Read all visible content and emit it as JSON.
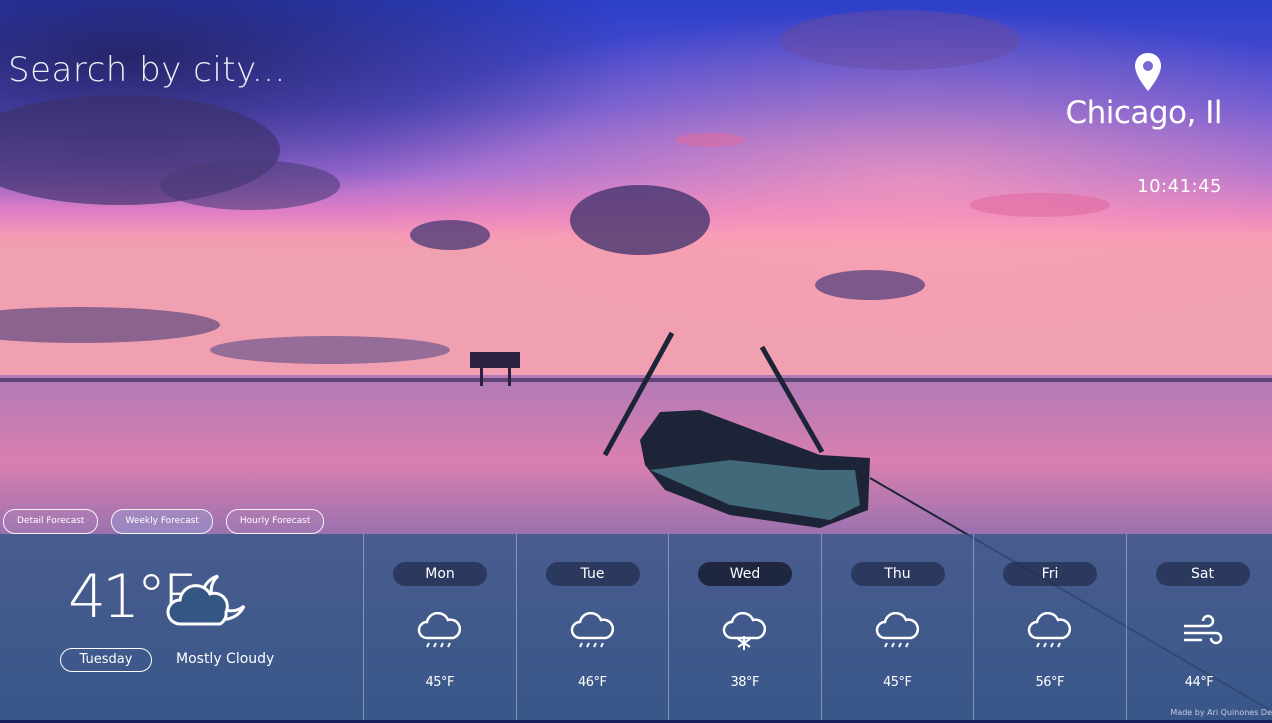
{
  "search": {
    "placeholder": "Search by city..."
  },
  "location": {
    "city": "Chicago, Il",
    "time": "10:41:45",
    "icon": "map-pin-icon"
  },
  "tabs": [
    {
      "label": "Detail Forecast",
      "active": false
    },
    {
      "label": "Weekly Forecast",
      "active": true
    },
    {
      "label": "Hourly Forecast",
      "active": false
    }
  ],
  "current": {
    "temp": "41°F",
    "day": "Tuesday",
    "condition": "Mostly Cloudy",
    "icon": "cloud-moon-icon"
  },
  "forecast": [
    {
      "day": "Mon",
      "temp": "45°F",
      "icon": "rain-cloud-icon"
    },
    {
      "day": "Tue",
      "temp": "46°F",
      "icon": "rain-cloud-icon"
    },
    {
      "day": "Wed",
      "temp": "38°F",
      "icon": "snow-cloud-icon"
    },
    {
      "day": "Thu",
      "temp": "45°F",
      "icon": "rain-cloud-icon"
    },
    {
      "day": "Fri",
      "temp": "56°F",
      "icon": "rain-cloud-icon"
    },
    {
      "day": "Sat",
      "temp": "44°F",
      "icon": "wind-icon"
    }
  ],
  "footer": "Made by Ari Quinones De"
}
